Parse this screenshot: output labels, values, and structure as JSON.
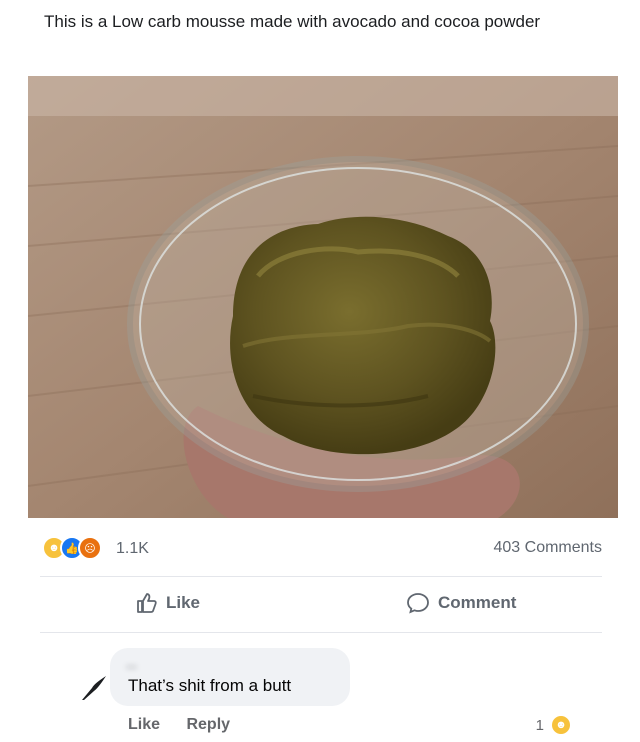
{
  "post": {
    "caption": "This is a Low carb mousse made with avocado and cocoa powder"
  },
  "stats": {
    "reaction_icons": [
      "haha-icon",
      "like-icon",
      "angry-icon"
    ],
    "reaction_count": "1.1K",
    "comments_count": "403 Comments"
  },
  "actions": {
    "like_label": "Like",
    "comment_label": "Comment"
  },
  "comment": {
    "author": "...",
    "text": "That’s shit from a butt",
    "like_label": "Like",
    "reply_label": "Reply",
    "reaction_count": "1",
    "reaction_icon": "haha-icon"
  },
  "colors": {
    "like_blue": "#1877f2",
    "haha_yellow": "#f7c23c",
    "angry_orange": "#e9710f",
    "secondary_text": "#606770"
  }
}
